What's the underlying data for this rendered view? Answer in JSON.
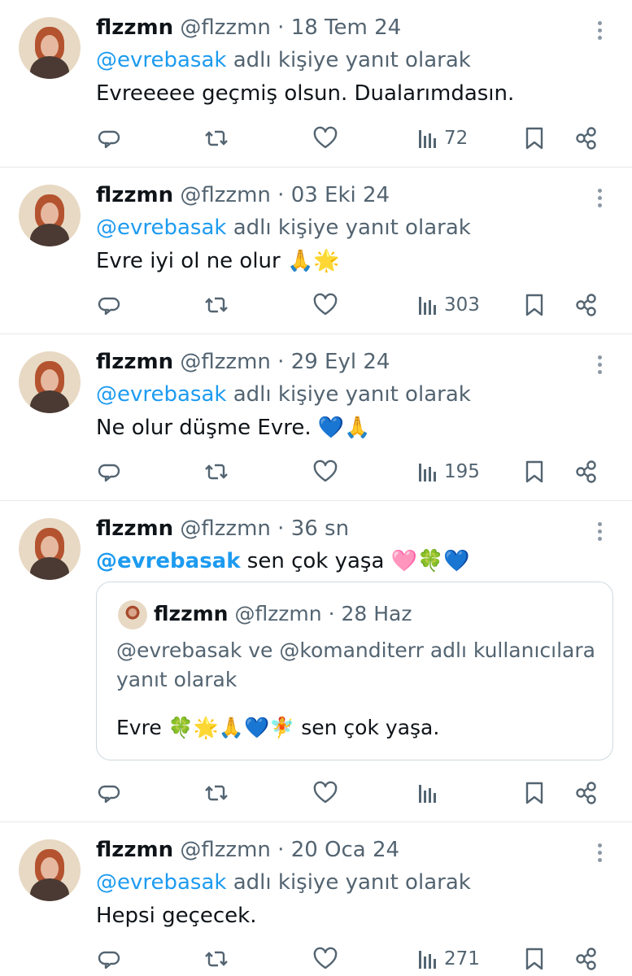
{
  "colors": {
    "mention": "#1d9bf0",
    "secondary": "#536471",
    "text": "#0f1419",
    "border": "#e6e9ec"
  },
  "tweets": [
    {
      "name": "flzzmn",
      "handle": "@flzzmn",
      "dot": "·",
      "time": "18 Tem 24",
      "reply_mention": "@evrebasak",
      "reply_suffix": " adlı kişiye yanıt olarak",
      "text": "Evreeeee geçmiş olsun. Dualarımdasın.",
      "views": "72"
    },
    {
      "name": "flzzmn",
      "handle": "@flzzmn",
      "dot": "·",
      "time": "03 Eki 24",
      "reply_mention": "@evrebasak",
      "reply_suffix": " adlı kişiye yanıt olarak",
      "text": "Evre iyi ol ne olur 🙏🌟",
      "views": "303"
    },
    {
      "name": "flzzmn",
      "handle": "@flzzmn",
      "dot": "·",
      "time": "29 Eyl 24",
      "reply_mention": "@evrebasak",
      "reply_suffix": " adlı kişiye yanıt olarak",
      "text": "Ne olur düşme Evre. 💙🙏",
      "views": "195"
    },
    {
      "name": "flzzmn",
      "handle": "@flzzmn",
      "dot": "·",
      "time": "36 sn",
      "text_mention": "@evrebasak",
      "text_suffix": "  sen çok yaşa 🩷🍀💙",
      "views": "",
      "quote": {
        "name": "flzzmn",
        "handle": "@flzzmn",
        "dot": "·",
        "time": "28 Haz",
        "reply": "@evrebasak ve @komanditerr adlı kullanıcılara yanıt olarak",
        "text": "Evre 🍀🌟🙏💙🧚 sen çok yaşa."
      }
    },
    {
      "name": "flzzmn",
      "handle": "@flzzmn",
      "dot": "·",
      "time": "20 Oca 24",
      "reply_mention": "@evrebasak",
      "reply_suffix": " adlı kişiye yanıt olarak",
      "text": "Hepsi geçecek.",
      "views": "271"
    }
  ]
}
